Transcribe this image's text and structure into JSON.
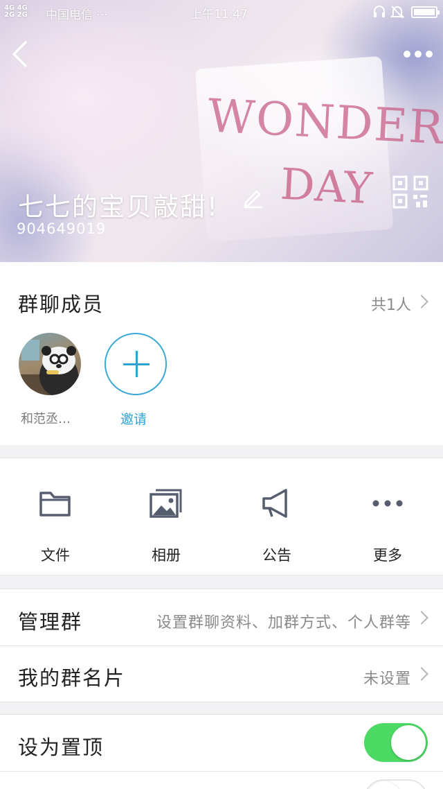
{
  "status_bar": {
    "signal_1": "4G 4G",
    "signal_2": "2G 2G",
    "carrier": "中国电信 ···",
    "time": "上午11:47",
    "icons": [
      "headset-icon",
      "bell-muted-icon",
      "battery-icon"
    ]
  },
  "header": {
    "group_name": "七七的宝贝敲甜!",
    "group_id": "904649019",
    "background_text_1": "WONDERFU",
    "background_text_2": "DAY",
    "icons": [
      "back-icon",
      "more-icon",
      "edit-icon",
      "qr-code-icon"
    ]
  },
  "members": {
    "title": "群聊成员",
    "count": "共1人",
    "list": [
      {
        "name": "和范丞…"
      }
    ],
    "invite_label": "邀请"
  },
  "actions": [
    {
      "label": "文件",
      "icon": "folder-icon"
    },
    {
      "label": "相册",
      "icon": "album-icon"
    },
    {
      "label": "公告",
      "icon": "megaphone-icon"
    },
    {
      "label": "更多",
      "icon": "more-dots-icon"
    }
  ],
  "manage": {
    "title": "管理群",
    "value": "设置群聊资料、加群方式、个人群等"
  },
  "card": {
    "title": "我的群名片",
    "value": "未设置"
  },
  "settings": {
    "pin_title": "设为置顶",
    "pin_enabled": true,
    "next_enabled": false
  },
  "colors": {
    "accent": "#2ea3d4",
    "toggle_on": "#4cd964",
    "icon_gray": "#555d6e"
  }
}
